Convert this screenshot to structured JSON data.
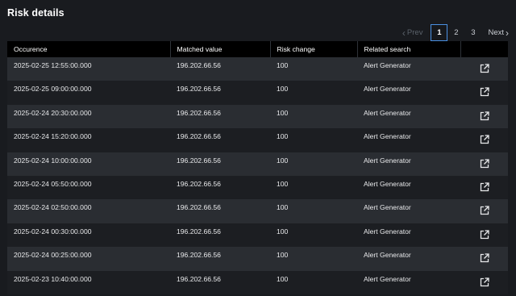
{
  "panel": {
    "title": "Risk details"
  },
  "pagination": {
    "prev_label": "Prev",
    "next_label": "Next",
    "pages": [
      "1",
      "2",
      "3"
    ],
    "current_page": "1"
  },
  "table": {
    "columns": [
      "Occurence",
      "Matched value",
      "Risk change",
      "Related search",
      ""
    ],
    "rows": [
      {
        "occurrence": "2025-02-25 12:55:00.000",
        "matched_value": "196.202.66.56",
        "risk_change": "100",
        "related_search": "Alert Generator",
        "action_icon": "external-link-icon"
      },
      {
        "occurrence": "2025-02-25 09:00:00.000",
        "matched_value": "196.202.66.56",
        "risk_change": "100",
        "related_search": "Alert Generator",
        "action_icon": "external-link-icon"
      },
      {
        "occurrence": "2025-02-24 20:30:00.000",
        "matched_value": "196.202.66.56",
        "risk_change": "100",
        "related_search": "Alert Generator",
        "action_icon": "external-link-icon"
      },
      {
        "occurrence": "2025-02-24 15:20:00.000",
        "matched_value": "196.202.66.56",
        "risk_change": "100",
        "related_search": "Alert Generator",
        "action_icon": "external-link-icon"
      },
      {
        "occurrence": "2025-02-24 10:00:00.000",
        "matched_value": "196.202.66.56",
        "risk_change": "100",
        "related_search": "Alert Generator",
        "action_icon": "external-link-icon"
      },
      {
        "occurrence": "2025-02-24 05:50:00.000",
        "matched_value": "196.202.66.56",
        "risk_change": "100",
        "related_search": "Alert Generator",
        "action_icon": "external-link-icon"
      },
      {
        "occurrence": "2025-02-24 02:50:00.000",
        "matched_value": "196.202.66.56",
        "risk_change": "100",
        "related_search": "Alert Generator",
        "action_icon": "external-link-icon"
      },
      {
        "occurrence": "2025-02-24 00:30:00.000",
        "matched_value": "196.202.66.56",
        "risk_change": "100",
        "related_search": "Alert Generator",
        "action_icon": "external-link-icon"
      },
      {
        "occurrence": "2025-02-24 00:25:00.000",
        "matched_value": "196.202.66.56",
        "risk_change": "100",
        "related_search": "Alert Generator",
        "action_icon": "external-link-icon"
      },
      {
        "occurrence": "2025-02-23 10:40:00.000",
        "matched_value": "196.202.66.56",
        "risk_change": "100",
        "related_search": "Alert Generator",
        "action_icon": "external-link-icon"
      }
    ]
  },
  "colors": {
    "background": "#191b1f",
    "header_row": "#000000",
    "row_odd": "#2a2d32",
    "row_even": "#1c1e22",
    "active_page_border": "#4a90e2",
    "disabled_text": "#5b626b"
  }
}
